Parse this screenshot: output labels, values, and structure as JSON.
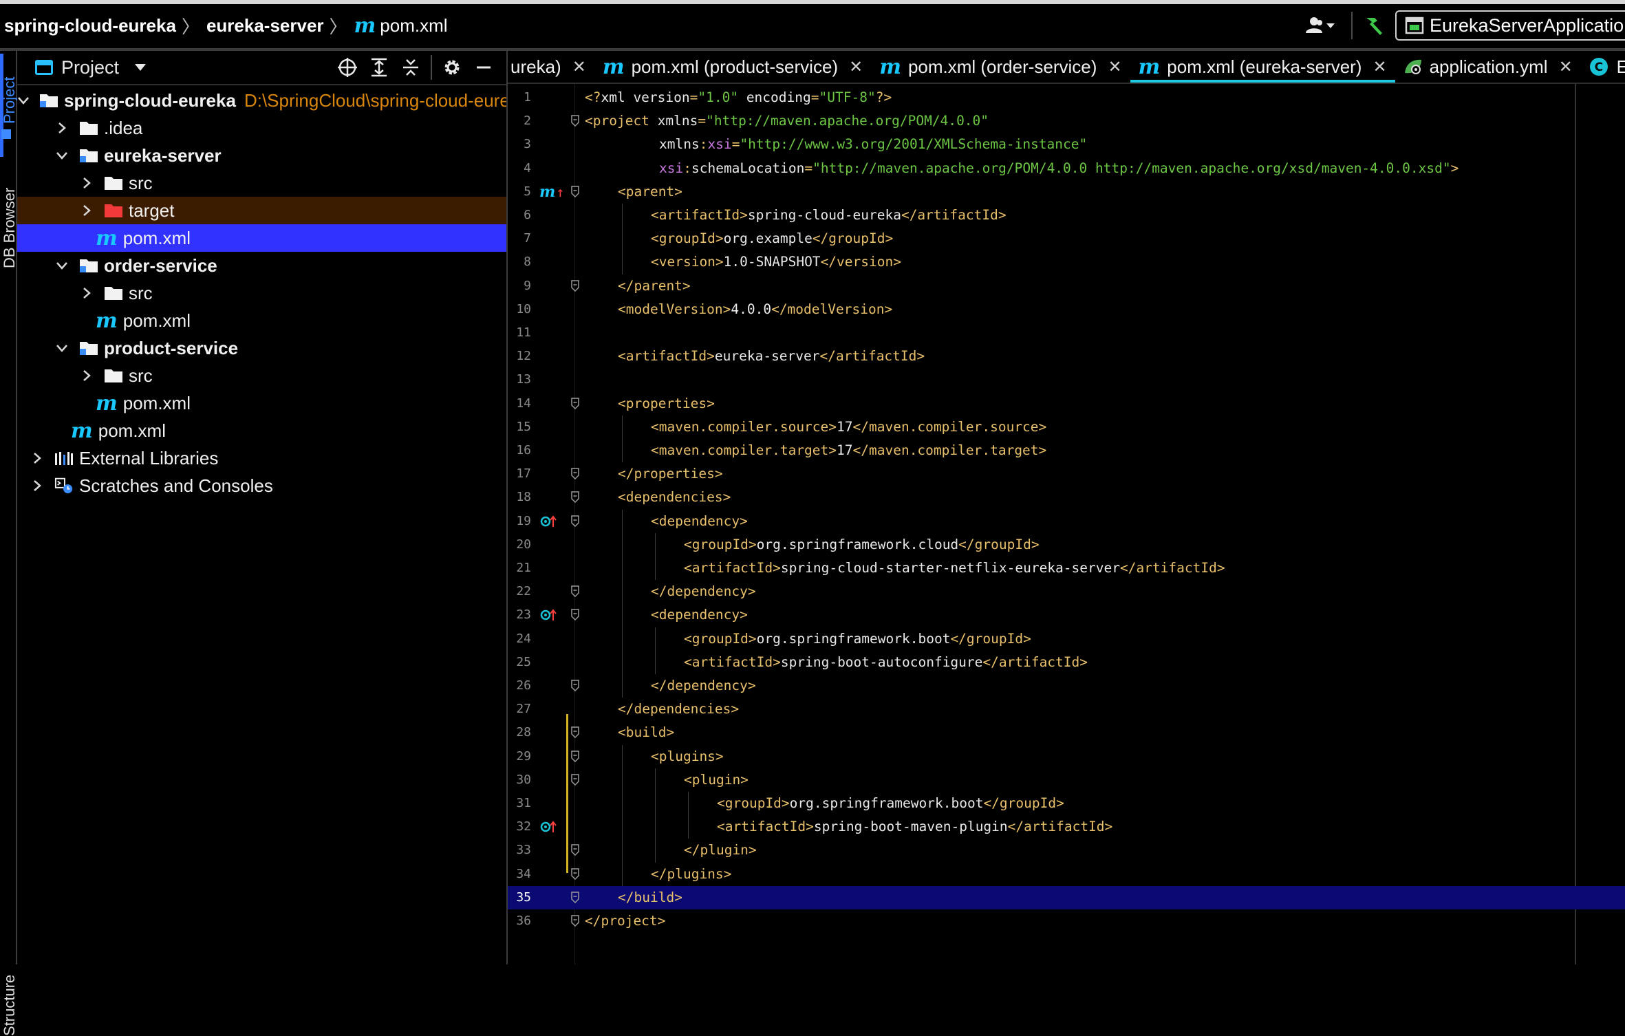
{
  "breadcrumb": {
    "root": "spring-cloud-eureka",
    "module": "eureka-server",
    "file_icon": "m",
    "file": "pom.xml"
  },
  "toolbar": {
    "run_config": "EurekaServerApplication"
  },
  "side_tabs": {
    "project": "Project",
    "db_browser": "DB Browser",
    "structure": "Structure"
  },
  "project_panel": {
    "title": "Project",
    "tree": [
      {
        "label": "spring-cloud-eureka",
        "path": "D:\\SpringCloud\\spring-cloud-eureka",
        "type": "module",
        "expanded": true,
        "bold": true
      },
      {
        "label": ".idea",
        "type": "folder",
        "expanded": false
      },
      {
        "label": "eureka-server",
        "type": "module",
        "expanded": true,
        "bold": true
      },
      {
        "label": "src",
        "type": "folder",
        "expanded": false
      },
      {
        "label": "target",
        "type": "excluded-folder",
        "expanded": false
      },
      {
        "label": "pom.xml",
        "type": "maven",
        "selected": true
      },
      {
        "label": "order-service",
        "type": "module",
        "expanded": true,
        "bold": true
      },
      {
        "label": "src",
        "type": "folder",
        "expanded": false
      },
      {
        "label": "pom.xml",
        "type": "maven"
      },
      {
        "label": "product-service",
        "type": "module",
        "expanded": true,
        "bold": true
      },
      {
        "label": "src",
        "type": "folder",
        "expanded": false
      },
      {
        "label": "pom.xml",
        "type": "maven"
      },
      {
        "label": "pom.xml",
        "type": "maven"
      },
      {
        "label": "External Libraries",
        "type": "libraries",
        "expanded": false
      },
      {
        "label": "Scratches and Consoles",
        "type": "scratches",
        "expanded": false
      }
    ]
  },
  "editor_tabs": [
    {
      "label": "ureka)",
      "icon": "none",
      "active": false
    },
    {
      "label": "pom.xml (product-service)",
      "icon": "m",
      "active": false
    },
    {
      "label": "pom.xml (order-service)",
      "icon": "m",
      "active": false
    },
    {
      "label": "pom.xml (eureka-server)",
      "icon": "m",
      "active": true
    },
    {
      "label": "application.yml",
      "icon": "spring",
      "active": false
    },
    {
      "label": "Eu",
      "icon": "class",
      "active": false
    }
  ],
  "colors": {
    "tag": "#e8bf6a",
    "string": "#6cc644",
    "namespace": "#c678dd",
    "maven_icon": "#18c8ff",
    "selection": "#3232ff",
    "current_line": "#0a0a72",
    "excluded_folder": "#f23a3a",
    "path": "#d9860f"
  },
  "code": {
    "current_line": 35,
    "lines": [
      {
        "n": "1",
        "indent": 0,
        "parts": [
          [
            "t",
            "<?"
          ],
          [
            "a",
            "xml version"
          ],
          [
            "t",
            "="
          ],
          [
            "s",
            "\"1.0\""
          ],
          [
            "a",
            " encoding"
          ],
          [
            "t",
            "="
          ],
          [
            "s",
            "\"UTF-8\""
          ],
          [
            "t",
            "?>"
          ]
        ]
      },
      {
        "n": "2",
        "indent": 0,
        "fold": true,
        "parts": [
          [
            "t",
            "<project "
          ],
          [
            "a",
            "xmlns"
          ],
          [
            "t",
            "="
          ],
          [
            "s",
            "\"http://maven.apache.org/POM/4.0.0\""
          ]
        ]
      },
      {
        "n": "3",
        "indent": 9,
        "parts": [
          [
            "a",
            "xmlns"
          ],
          [
            "t",
            ":"
          ],
          [
            "ns",
            "xsi"
          ],
          [
            "t",
            "="
          ],
          [
            "s",
            "\"http://www.w3.org/2001/XMLSchema-instance\""
          ]
        ]
      },
      {
        "n": "4",
        "indent": 9,
        "parts": [
          [
            "ns",
            "xsi"
          ],
          [
            "t",
            ":"
          ],
          [
            "a",
            "schemaLocation"
          ],
          [
            "t",
            "="
          ],
          [
            "s",
            "\"http://maven.apache.org/POM/4.0.0 http://maven.apache.org/xsd/maven-4.0.0.xsd\""
          ],
          [
            "t",
            ">"
          ]
        ]
      },
      {
        "n": "5",
        "indent": 4,
        "fold": true,
        "gicon": "maven-up",
        "parts": [
          [
            "t",
            "<parent>"
          ]
        ]
      },
      {
        "n": "6",
        "indent": 8,
        "parts": [
          [
            "t",
            "<artifactId>"
          ],
          [
            "a",
            "spring-cloud-eureka"
          ],
          [
            "t",
            "</artifactId>"
          ]
        ]
      },
      {
        "n": "7",
        "indent": 8,
        "parts": [
          [
            "t",
            "<groupId>"
          ],
          [
            "a",
            "org.example"
          ],
          [
            "t",
            "</groupId>"
          ]
        ]
      },
      {
        "n": "8",
        "indent": 8,
        "parts": [
          [
            "t",
            "<version>"
          ],
          [
            "a",
            "1.0-SNAPSHOT"
          ],
          [
            "t",
            "</version>"
          ]
        ]
      },
      {
        "n": "9",
        "indent": 4,
        "fold": true,
        "parts": [
          [
            "t",
            "</parent>"
          ]
        ]
      },
      {
        "n": "10",
        "indent": 4,
        "parts": [
          [
            "t",
            "<modelVersion>"
          ],
          [
            "a",
            "4.0.0"
          ],
          [
            "t",
            "</modelVersion>"
          ]
        ]
      },
      {
        "n": "11",
        "indent": 0,
        "parts": []
      },
      {
        "n": "12",
        "indent": 4,
        "parts": [
          [
            "t",
            "<artifactId>"
          ],
          [
            "a",
            "eureka-server"
          ],
          [
            "t",
            "</artifactId>"
          ]
        ]
      },
      {
        "n": "13",
        "indent": 0,
        "parts": []
      },
      {
        "n": "14",
        "indent": 4,
        "fold": true,
        "parts": [
          [
            "t",
            "<properties>"
          ]
        ]
      },
      {
        "n": "15",
        "indent": 8,
        "parts": [
          [
            "t",
            "<maven.compiler.source>"
          ],
          [
            "a",
            "17"
          ],
          [
            "t",
            "</maven.compiler.source>"
          ]
        ]
      },
      {
        "n": "16",
        "indent": 8,
        "parts": [
          [
            "t",
            "<maven.compiler.target>"
          ],
          [
            "a",
            "17"
          ],
          [
            "t",
            "</maven.compiler.target>"
          ]
        ]
      },
      {
        "n": "17",
        "indent": 4,
        "fold": true,
        "parts": [
          [
            "t",
            "</properties>"
          ]
        ]
      },
      {
        "n": "18",
        "indent": 4,
        "fold": true,
        "parts": [
          [
            "t",
            "<dependencies>"
          ]
        ]
      },
      {
        "n": "19",
        "indent": 8,
        "fold": true,
        "gicon": "override-up",
        "parts": [
          [
            "t",
            "<dependency>"
          ]
        ]
      },
      {
        "n": "20",
        "indent": 12,
        "parts": [
          [
            "t",
            "<groupId>"
          ],
          [
            "a",
            "org.springframework.cloud"
          ],
          [
            "t",
            "</groupId>"
          ]
        ]
      },
      {
        "n": "21",
        "indent": 12,
        "parts": [
          [
            "t",
            "<artifactId>"
          ],
          [
            "a",
            "spring-cloud-starter-netflix-eureka-server"
          ],
          [
            "t",
            "</artifactId>"
          ]
        ]
      },
      {
        "n": "22",
        "indent": 8,
        "fold": true,
        "parts": [
          [
            "t",
            "</dependency>"
          ]
        ]
      },
      {
        "n": "23",
        "indent": 8,
        "fold": true,
        "gicon": "override-up",
        "parts": [
          [
            "t",
            "<dependency>"
          ]
        ]
      },
      {
        "n": "24",
        "indent": 12,
        "parts": [
          [
            "t",
            "<groupId>"
          ],
          [
            "a",
            "org.springframework.boot"
          ],
          [
            "t",
            "</groupId>"
          ]
        ]
      },
      {
        "n": "25",
        "indent": 12,
        "parts": [
          [
            "t",
            "<artifactId>"
          ],
          [
            "a",
            "spring-boot-autoconfigure"
          ],
          [
            "t",
            "</artifactId>"
          ]
        ]
      },
      {
        "n": "26",
        "indent": 8,
        "fold": true,
        "parts": [
          [
            "t",
            "</dependency>"
          ]
        ]
      },
      {
        "n": "27",
        "indent": 4,
        "parts": [
          [
            "t",
            "</dependencies>"
          ]
        ]
      },
      {
        "n": "28",
        "indent": 4,
        "fold": true,
        "parts": [
          [
            "t",
            "<build>"
          ]
        ]
      },
      {
        "n": "29",
        "indent": 8,
        "fold": true,
        "parts": [
          [
            "t",
            "<plugins>"
          ]
        ]
      },
      {
        "n": "30",
        "indent": 12,
        "fold": true,
        "parts": [
          [
            "t",
            "<plugin>"
          ]
        ]
      },
      {
        "n": "31",
        "indent": 16,
        "parts": [
          [
            "t",
            "<groupId>"
          ],
          [
            "a",
            "org.springframework.boot"
          ],
          [
            "t",
            "</groupId>"
          ]
        ]
      },
      {
        "n": "32",
        "indent": 16,
        "gicon": "override-up",
        "parts": [
          [
            "t",
            "<artifactId>"
          ],
          [
            "a",
            "spring-boot-maven-plugin"
          ],
          [
            "t",
            "</artifactId>"
          ]
        ]
      },
      {
        "n": "33",
        "indent": 12,
        "fold": true,
        "parts": [
          [
            "t",
            "</plugin>"
          ]
        ]
      },
      {
        "n": "34",
        "indent": 8,
        "fold": true,
        "parts": [
          [
            "t",
            "</plugins>"
          ]
        ]
      },
      {
        "n": "35",
        "indent": 4,
        "fold": true,
        "parts": [
          [
            "t",
            "</build>"
          ]
        ]
      },
      {
        "n": "36",
        "indent": 0,
        "fold": true,
        "parts": [
          [
            "t",
            "</project>"
          ]
        ]
      }
    ]
  }
}
